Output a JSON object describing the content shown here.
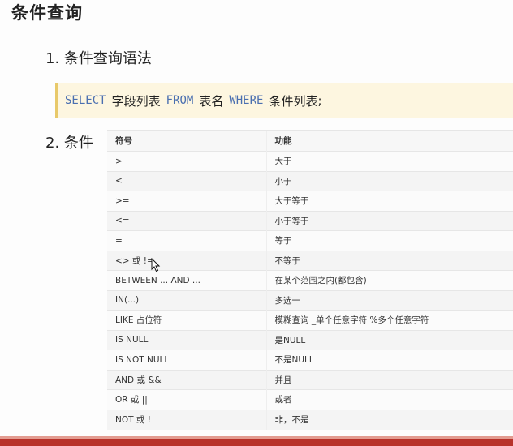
{
  "title": "条件查询",
  "section1": {
    "label": "1. 条件查询语法",
    "code": {
      "kw_select": "SELECT",
      "fields": "字段列表",
      "kw_from": "FROM",
      "table": "表名",
      "kw_where": "WHERE",
      "conditions": "条件列表",
      "end": ";"
    }
  },
  "section2": {
    "label": "2. 条件",
    "table": {
      "headers": [
        "符号",
        "功能"
      ],
      "rows": [
        [
          ">",
          "大于"
        ],
        [
          "<",
          "小于"
        ],
        [
          ">=",
          "大于等于"
        ],
        [
          "<=",
          "小于等于"
        ],
        [
          "=",
          "等于"
        ],
        [
          "<> 或 !=",
          "不等于"
        ],
        [
          "BETWEEN ... AND ...",
          "在某个范围之内(都包含)"
        ],
        [
          "IN(...)",
          "多选一"
        ],
        [
          "LIKE 占位符",
          "模糊查询 _单个任意字符 %多个任意字符"
        ],
        [
          "IS NULL",
          "是NULL"
        ],
        [
          "IS NOT NULL",
          "不是NULL"
        ],
        [
          "AND 或 &&",
          "并且"
        ],
        [
          "OR 或 ||",
          "或者"
        ],
        [
          "NOT 或 !",
          "非，不是"
        ]
      ]
    }
  },
  "colors": {
    "code_bg": "#fdf6e0",
    "code_border": "#e8c96a",
    "keyword": "#4a6fb0",
    "bottom_bar": "#b8322a"
  },
  "icons": {
    "cursor": "mouse-pointer-icon"
  }
}
